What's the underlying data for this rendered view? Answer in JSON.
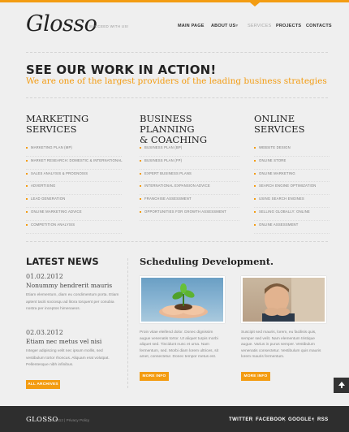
{
  "colors": {
    "accent": "#f39c12",
    "footer_bg": "#2e2e2e",
    "page_bg": "#efefef"
  },
  "header": {
    "logo": "Glosso",
    "tagline": "SUCCEED WITH US!",
    "nav": [
      "MAIN PAGE",
      "ABOUT US",
      "SERVICES",
      "PROJECTS",
      "CONTACTS"
    ],
    "nav_active": "SERVICES",
    "about_caret": "▾"
  },
  "hero": {
    "title": "SEE OUR WORK IN ACTION!",
    "subtitle": "We are one of the largest providers of the leading business strategies"
  },
  "services": [
    {
      "title_line1": "MARKETING",
      "title_line2": "SERVICES",
      "items": [
        "MARKETING PLAN (MP)",
        "MARKET RESEARCH: DOMESTIC & INTERNATIONAL",
        "SALES ANALYSIS & PROGNOSIS",
        "ADVERTISING",
        "LEAD GENERATION",
        "ONLINE MARKETING ADVICE",
        "COMPETITION ANALYSIS"
      ]
    },
    {
      "title_line1": "BUSINESS PLANNING",
      "title_line2": "& COACHING",
      "items": [
        "BUSINESS PLAN (BP)",
        "BUSINESS PLAN (FP)",
        "EXPERT BUSINESS PLANS",
        "INTERNATIONAL EXPANSION ADVICE",
        "FRANCHISE ASSESSMENT",
        "OPPORTUNITIES FOR GROWTH ASSESSMENT"
      ]
    },
    {
      "title_line1": "ONLINE",
      "title_line2": "SERVICES",
      "items": [
        "WEBSITE DESIGN",
        "ONLINE STORE",
        "ONLINE MARKETING",
        "SEARCH ENGINE OPTIMIZATION",
        "USING SEARCH ENGINES",
        "SELLING GLOBALLY: ONLINE",
        "ONLINE ASSESSMENT"
      ]
    }
  ],
  "news": {
    "title": "LATEST NEWS",
    "items": [
      {
        "date": "01.02.2012",
        "headline": "Nonummy hendrerit mauris",
        "text": "Etiam elementum, diam eu condimentum porta. Etiam aptent taciti sociosqu ad litora torquent per conubia nostra per inceptos himenaeos."
      },
      {
        "date": "02.03.2012",
        "headline": "Etiam nec metus vel nisi",
        "text": "Integer adipiscing velit nec ipsum mollis, sed vestibulum tortor rhoncus. Aliquam erat volutpat. Pellentesque nibh infinibus."
      }
    ],
    "button": "ALL ARCHIVES"
  },
  "schedule": {
    "title": "Scheduling Development.",
    "items": [
      {
        "text": "Proin vitae eleifend dolor. Donec dignissim augue venenatis tortor. Ut aliquet turpis morbi aliquet sed. Tincidunt nunc et urna. Nam fermentum, sed. Morbi diam lorem ultrices, sit amet, consectetur. Donec tempor metus est.",
        "button": "MORE INFO"
      },
      {
        "text": "Suscipit sed mauris, lorem, eu facilisis quis, semper sed velit. Nam elementum tristique augue. Varius in purus semper. Vestibulum venenatis consectetur. Vestibulum quis mauris lorem mauris fermentum.",
        "button": "MORE INFO"
      }
    ]
  },
  "footer": {
    "logo": "GLOSSO",
    "copyright": "© 2012  |  Privacy Policy",
    "links": [
      "TWITTER",
      "FACEBOOK",
      "GOOGLE+",
      "RSS"
    ],
    "separator": "|"
  }
}
